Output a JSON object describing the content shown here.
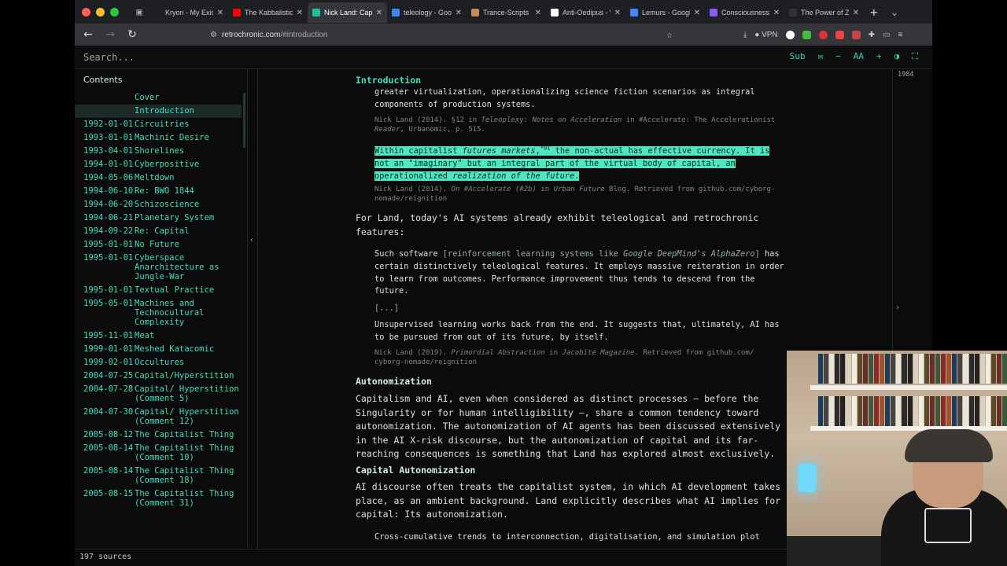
{
  "browser": {
    "tabs": [
      {
        "title": "Kryon - My Existe",
        "color": "#1f1f1f"
      },
      {
        "title": "The Kabbalistic V",
        "color": "#ff0000"
      },
      {
        "title": "Nick Land: Capit",
        "color": "#19c3a0",
        "active": true
      },
      {
        "title": "teleology - Goog",
        "color": "#4285f4"
      },
      {
        "title": "Trance-Scripts",
        "color": "#c9875a"
      },
      {
        "title": "Anti-Oedipus - W",
        "color": "#ffffff"
      },
      {
        "title": "Lemurs - Google",
        "color": "#4285f4"
      },
      {
        "title": "Consciousness I",
        "color": "#8a5cf6"
      },
      {
        "title": "The Power of Zero -",
        "color": "#333333"
      }
    ],
    "url_host": "retrochronic.com",
    "url_path": "/#introduction",
    "vpn_label": "VPN"
  },
  "app": {
    "search_placeholder": "Search...",
    "tools": {
      "sub": "Sub",
      "mail": "✉",
      "minus": "−",
      "font": "AA",
      "plus": "+",
      "contrast": "◑",
      "fullscreen": "⛶"
    },
    "contents_title": "Contents",
    "year_label": "1984",
    "sources_count": "197 sources"
  },
  "toc": [
    {
      "date": "",
      "title": "Cover"
    },
    {
      "date": "",
      "title": "Introduction",
      "active": true
    },
    {
      "date": "1992-01-01",
      "title": "Circuitries"
    },
    {
      "date": "1993-01-01",
      "title": "Machinic Desire"
    },
    {
      "date": "1993-04-01",
      "title": "Shorelines"
    },
    {
      "date": "1994-01-01",
      "title": "Cyberpositive"
    },
    {
      "date": "1994-05-06",
      "title": "Meltdown"
    },
    {
      "date": "1994-06-10",
      "title": "Re: BWO 1844"
    },
    {
      "date": "1994-06-20",
      "title": "Schizoscience"
    },
    {
      "date": "1994-06-21",
      "title": "Planetary System"
    },
    {
      "date": "1994-09-22",
      "title": "Re: Capital"
    },
    {
      "date": "1995-01-01",
      "title": "No Future"
    },
    {
      "date": "1995-01-01",
      "title": "Cyberspace Anarchitecture as Jungle-War"
    },
    {
      "date": "1995-01-01",
      "title": "Textual Practice"
    },
    {
      "date": "1995-05-01",
      "title": "Machines and Technocultural Complexity"
    },
    {
      "date": "1995-11-01",
      "title": "Meat"
    },
    {
      "date": "1999-01-01",
      "title": "Meshed Katacomic"
    },
    {
      "date": "1999-02-01",
      "title": "Occultures"
    },
    {
      "date": "2004-07-25",
      "title": "Capital/Hyperstition"
    },
    {
      "date": "2004-07-28",
      "title": "Capital/ Hyperstition (Comment 5)"
    },
    {
      "date": "2004-07-30",
      "title": "Capital/ Hyperstition (Comment 12)"
    },
    {
      "date": "2005-08-12",
      "title": "The Capitalist Thing"
    },
    {
      "date": "2005-08-14",
      "title": "The Capitalist Thing (Comment 10)"
    },
    {
      "date": "2005-08-14",
      "title": "The Capitalist Thing (Comment 18)"
    },
    {
      "date": "2005-08-15",
      "title": "The Capitalist Thing (Comment 31)"
    }
  ],
  "article": {
    "section_title": "Introduction",
    "top_line_1": "greater virtualization, operationalizing science fiction scenarios as integral",
    "top_line_2": "components of production systems.",
    "cite1_a": "Nick Land (2014). §12 in ",
    "cite1_i": "Teleoplexy: Notes on Acceleration",
    "cite1_b": " in #Accelerate: The Accelerationist",
    "cite1_c": "Reader",
    "cite1_d": ", Urbanomic, p. 515.",
    "hl_a": "Within capitalist ",
    "hl_i1": "futures markets",
    "hl_b": ",",
    "hl_sup": "*01",
    "hl_c": " the non-actual has effective currency. It is",
    "hl_line2": "not an \"imaginary\" but an integral part of the virtual body of capital, an",
    "hl_line3a": "operationalized ",
    "hl_line3i": "realization of the future",
    "hl_line3b": ".",
    "cite2_a": "Nick Land (2014). ",
    "cite2_i": "On #Accelerate (#2b)",
    "cite2_b": " in ",
    "cite2_i2": "Urban Future",
    "cite2_c": " Blog. Retrieved from github.com/cyborg-",
    "cite2_d": "nomade/reignition",
    "p1": "For Land, today's AI systems already exhibit teleological and retrochronic features:",
    "q1_a": "Such software ",
    "q1_br1": "[reinforcement learning systems like ",
    "q1_bri": "Google DeepMind's AlphaZero",
    "q1_br2": "]",
    "q1_b": " has certain distinctively teleological features. It employs massive reiteration in order to learn from outcomes. Performance improvement thus tends to descend from the future.",
    "ellipsis": "[...]",
    "q2": "Unsupervised learning works back from the end. It suggests that, ultimately, AI has to be pursued from out of its future, by itself.",
    "cite3_a": "Nick Land (2019). ",
    "cite3_i": "Primordial Abstraction",
    "cite3_b": " in ",
    "cite3_i2": "Jacobite Magazine",
    "cite3_c": ". Retrieved from github.com/",
    "cite3_d": "cyborg-nomade/reignition",
    "h_auto": "Autonomization",
    "p2": "Capitalism and AI, even when considered as distinct processes — before the Singularity or for human intelligibility —, share a common tendency toward autonomization. The autonomization of AI agents has been discussed extensively in the AI X-risk discourse, but the autonomization of capital and its far-reaching consequences is something that Land has explored almost exclusively.",
    "h_cap": "Capital Autonomization",
    "p3": "AI discourse often treats the capitalist system, in which AI development takes place, as an ambient background. Land explicitly describes what AI implies for capital: Its autonomization.",
    "q3": "Cross-cumulative trends to interconnection, digitalisation, and simulation plot"
  }
}
